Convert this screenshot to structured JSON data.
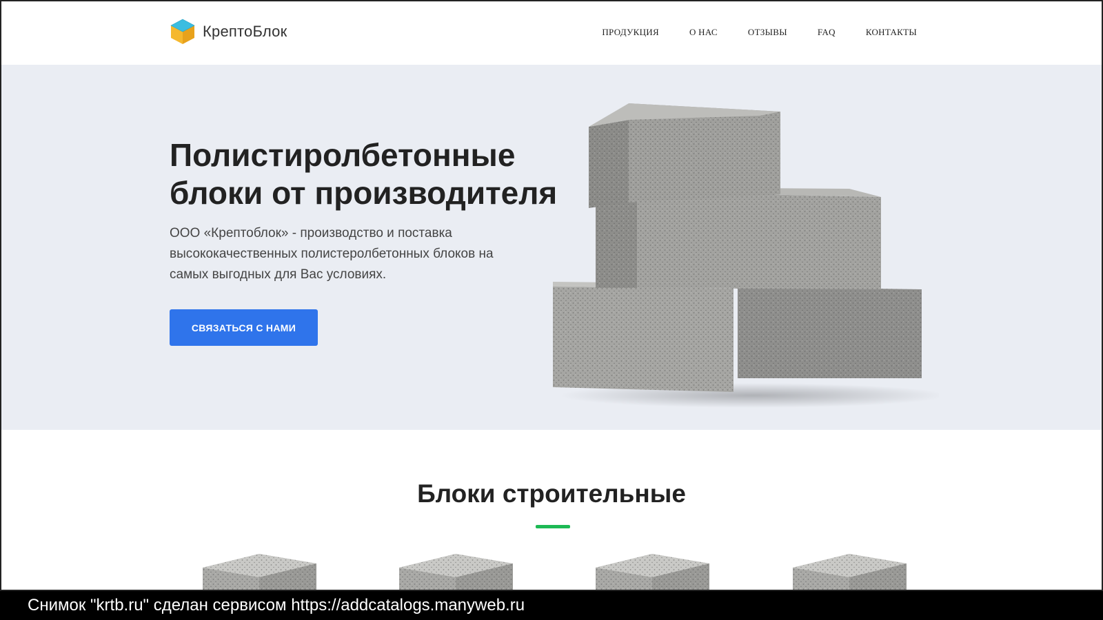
{
  "brand": {
    "name": "КрептоБлок",
    "colors": {
      "cube_top": "#3bbde0",
      "cube_left": "#f5b82e",
      "cube_right": "#e8a21c"
    }
  },
  "nav": {
    "items": [
      {
        "label": "ПРОДУКЦИЯ"
      },
      {
        "label": "О НАС"
      },
      {
        "label": "ОТЗЫВЫ"
      },
      {
        "label": "FAQ"
      },
      {
        "label": "КОНТАКТЫ"
      }
    ]
  },
  "hero": {
    "title": "Полистиролбетонные блоки от производителя",
    "lead": "ООО «Крептоблок» - производство и поставка высококачественных полистеролбетонных блоков на самых выгодных для Вас условиях.",
    "cta_label": "СВЯЗАТЬСЯ С НАМИ",
    "cta_color": "#2f74eb",
    "background": "#eaedf3"
  },
  "section": {
    "title": "Блоки строительные",
    "accent_color": "#1db954"
  },
  "caption": {
    "text": "Снимок \"krtb.ru\" сделан сервисом https://addcatalogs.manyweb.ru"
  }
}
